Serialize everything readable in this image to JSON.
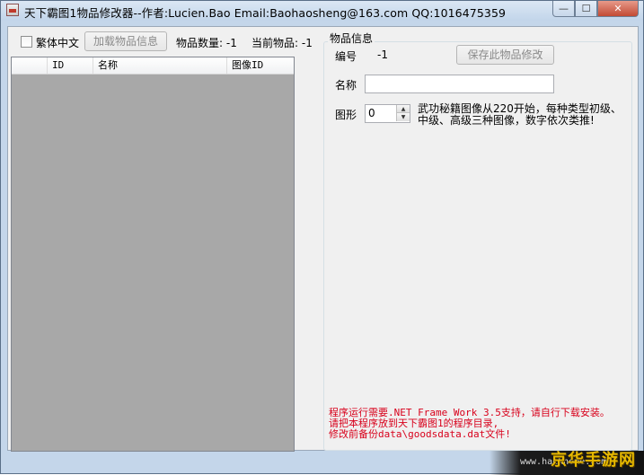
{
  "window": {
    "title": "天下霸图1物品修改器--作者:Lucien.Bao    Email:Baohaosheng@163.com  QQ:1016475359",
    "min_symbol": "—",
    "max_symbol": "☐",
    "close_symbol": "✕"
  },
  "toolbar": {
    "traditional_label": "繁体中文",
    "traditional_checked": false,
    "load_button": "加载物品信息",
    "item_count_label": "物品数量: -1",
    "current_item_label": "当前物品: -1"
  },
  "list": {
    "columns": [
      "",
      "ID",
      "名称",
      "图像ID"
    ],
    "rows": []
  },
  "item_info": {
    "group_title": "物品信息",
    "number_label": "编号",
    "number_value": "-1",
    "save_button": "保存此物品修改",
    "name_label": "名称",
    "name_value": "",
    "shape_label": "图形",
    "shape_value": "0",
    "shape_hint": "武功秘籍图像从220开始，每种类型初级、中级、高级三种图像，数字依次类推!"
  },
  "notes": [
    "程序运行需要.NET Frame Work 3.5支持，请自行下载安装。",
    "请把本程序放到天下霸图1的程序目录,",
    "修改前备份data\\goodsdata.dat文件!"
  ],
  "watermark": {
    "site": "www.hackhome.com",
    "brand": "京华手游网"
  }
}
